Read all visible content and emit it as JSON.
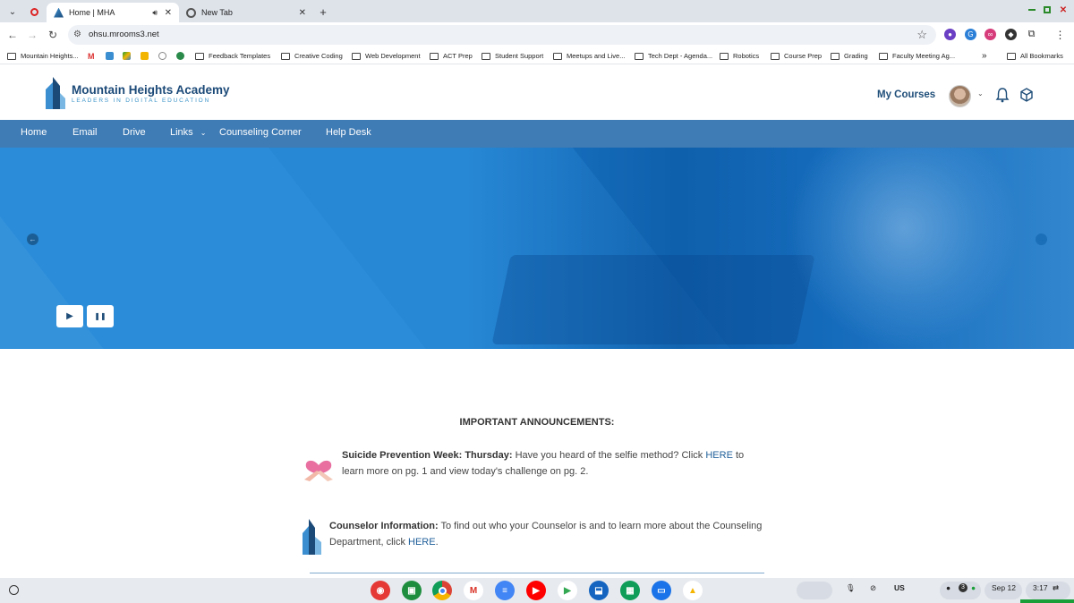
{
  "browser": {
    "tabs": [
      {
        "title": "Home | MHA",
        "active": true,
        "audio": true
      },
      {
        "title": "New Tab",
        "active": false
      }
    ],
    "url": "ohsu.mrooms3.net",
    "bookmarks": [
      "Mountain Heights...",
      "Feedback Templates",
      "Creative Coding",
      "Web Development",
      "ACT Prep",
      "Student Support",
      "Meetups and Live...",
      "Tech Dept - Agenda...",
      "Robotics",
      "Course Prep",
      "Grading",
      "Faculty Meeting Ag..."
    ],
    "all_bookmarks": "All Bookmarks",
    "more_bookmarks": "»"
  },
  "site": {
    "logo_name": "Mountain Heights Academy",
    "logo_tagline": "LEADERS IN DIGITAL EDUCATION",
    "my_courses": "My Courses"
  },
  "nav": {
    "items": [
      "Home",
      "Email",
      "Drive",
      "Links",
      "Counseling Corner",
      "Help Desk"
    ],
    "links_chevron": "⌄"
  },
  "hero": {
    "play_icon": "▶",
    "pause_icon": "❚❚"
  },
  "announcements": {
    "title": "IMPORTANT ANNOUNCEMENTS:",
    "items": [
      {
        "heading": "Suicide Prevention Week: Thursday:",
        "text_before": " Have you heard of the selfie method? Click ",
        "link": "HERE",
        "text_after": " to",
        "line2": "learn more on pg. 1 and view today's challenge on pg. 2."
      },
      {
        "heading": "Counselor Information:",
        "text_before": " To find out who your Counselor is and to learn more about the Counseling",
        "line2_before": "Department, click ",
        "link": "HERE",
        "line2_after": "."
      }
    ]
  },
  "shelf": {
    "keyboard": "US",
    "date": "Sep 12",
    "time": "3:17",
    "notifications": "3"
  },
  "colors": {
    "brand_navy": "#1c4a78",
    "nav_blue": "#3f7bb4",
    "hero_blue": "#1a78c7",
    "link_blue": "#1f5f9a"
  }
}
